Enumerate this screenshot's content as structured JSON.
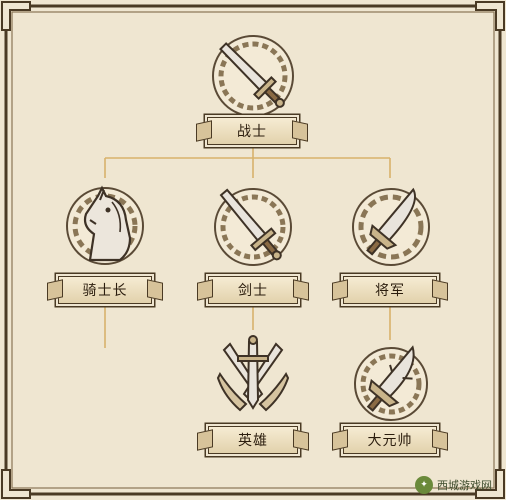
{
  "nodes": {
    "warrior": "战士",
    "knight_captain": "骑士长",
    "swordsman": "剑士",
    "general": "将军",
    "hero": "英雄",
    "grand_marshal": "大元帅"
  },
  "watermark": "西城游戏网",
  "colors": {
    "background": "#efe6d1",
    "frame": "#4a3a24",
    "plate": "#e8d9b5",
    "connector": "#d8b26b",
    "emblem_line": "#5a4a36"
  }
}
